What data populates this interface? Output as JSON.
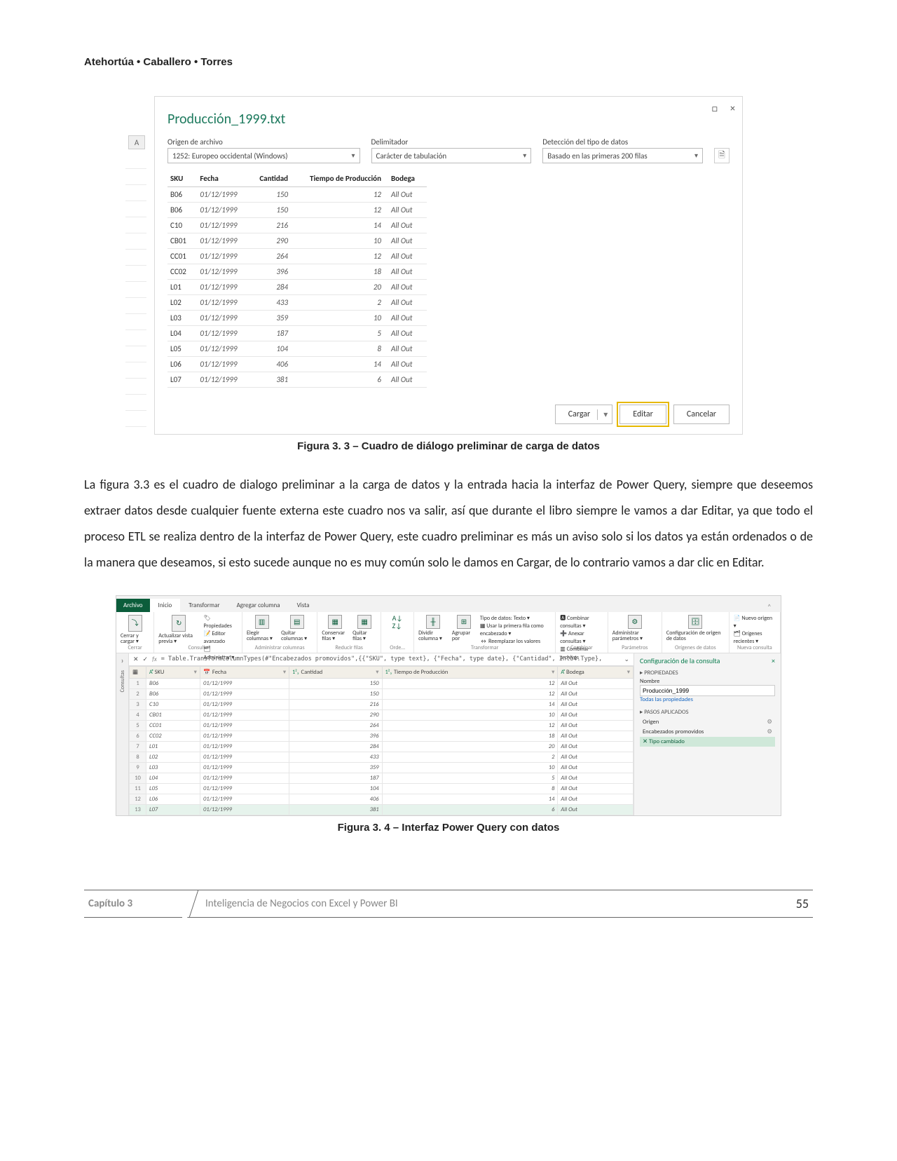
{
  "header_authors": "Atehortúa • Caballero • Torres",
  "fig33": {
    "window": {
      "minimize": "□",
      "close": "×"
    },
    "title": "Producción_1999.txt",
    "col_a": "A",
    "labels": {
      "origen": "Origen de archivo",
      "delim": "Delimitador",
      "detect": "Detección del tipo de datos"
    },
    "selects": {
      "origen": "1252: Europeo occidental (Windows)",
      "delim": "Carácter de tabulación",
      "detect": "Basado en las primeras 200 filas"
    },
    "doc_icon": "🗎",
    "headers": [
      "SKU",
      "Fecha",
      "Cantidad",
      "Tiempo de Producción",
      "Bodega"
    ],
    "rows": [
      [
        "B06",
        "01/12/1999",
        "150",
        "12",
        "All Out"
      ],
      [
        "B06",
        "01/12/1999",
        "150",
        "12",
        "All Out"
      ],
      [
        "C10",
        "01/12/1999",
        "216",
        "14",
        "All Out"
      ],
      [
        "CB01",
        "01/12/1999",
        "290",
        "10",
        "All Out"
      ],
      [
        "CC01",
        "01/12/1999",
        "264",
        "12",
        "All Out"
      ],
      [
        "CC02",
        "01/12/1999",
        "396",
        "18",
        "All Out"
      ],
      [
        "L01",
        "01/12/1999",
        "284",
        "20",
        "All Out"
      ],
      [
        "L02",
        "01/12/1999",
        "433",
        "2",
        "All Out"
      ],
      [
        "L03",
        "01/12/1999",
        "359",
        "10",
        "All Out"
      ],
      [
        "L04",
        "01/12/1999",
        "187",
        "5",
        "All Out"
      ],
      [
        "L05",
        "01/12/1999",
        "104",
        "8",
        "All Out"
      ],
      [
        "L06",
        "01/12/1999",
        "406",
        "14",
        "All Out"
      ],
      [
        "L07",
        "01/12/1999",
        "381",
        "6",
        "All Out"
      ]
    ],
    "buttons": {
      "cargar": "Cargar",
      "editar": "Editar",
      "cancelar": "Cancelar"
    },
    "caption": "Figura 3. 3 – Cuadro de diálogo preliminar de carga de datos"
  },
  "paragraph": "La figura 3.3 es el cuadro de dialogo preliminar a la carga de datos y la entrada hacia la interfaz de Power Query, siempre que deseemos extraer datos desde cualquier fuente externa este cuadro nos va salir, así que durante el libro siempre le vamos a dar Editar, ya que todo el proceso ETL se realiza dentro de la interfaz de Power Query, este cuadro preliminar es más un aviso solo si los datos ya están ordenados o de la manera que deseamos, si esto sucede aunque no es muy común solo le damos en Cargar, de lo contrario vamos a dar clic en Editar.",
  "fig34": {
    "tabs": {
      "file": "Archivo",
      "inicio": "Inicio",
      "transformar": "Transformar",
      "agregar": "Agregar columna",
      "vista": "Vista"
    },
    "ribbon_caps": {
      "cerrar": "Cerrar",
      "consulta": "Consulta",
      "admincol": "Administrar columnas",
      "reducir": "Reducir filas",
      "orde": "Orde…",
      "transformar": "Transformar",
      "combinar": "Combinar",
      "param": "Parámetros",
      "origenes": "Orígenes de datos",
      "nueva": "Nueva consulta"
    },
    "ribbon_labels": {
      "cerrar": "Cerrar y cargar ▾",
      "actualizar": "Actualizar vista previa ▾",
      "propiedades": "Propiedades",
      "editor": "Editor avanzado",
      "administrar": "Administrar ▾",
      "elegir": "Elegir columnas ▾",
      "quitar": "Quitar columnas ▾",
      "conservar": "Conservar filas ▾",
      "quitarf": "Quitar filas ▾",
      "dividir": "Dividir columna ▾",
      "agrupar": "Agrupar por",
      "tipo": "Tipo de datos: Texto ▾",
      "primera": "Usar la primera fila como encabezado ▾",
      "reemplazar": "Reemplazar los valores",
      "combinarc": "Combinar consultas ▾",
      "anexar": "Anexar consultas ▾",
      "combinararch": "Combinar archivos",
      "adminparam": "Administrar parámetros ▾",
      "config": "Configuración de origen de datos",
      "nuevoorigen": "Nuevo origen ▾",
      "recientes": "Orígenes recientes ▾"
    },
    "vertical_label": "Consultas",
    "formula": "= Table.TransformColumnTypes(#\"Encabezados promovidos\",{{\"SKU\", type text}, {\"Fecha\", type date}, {\"Cantidad\", Int64.Type},",
    "grid_headers": [
      "SKU",
      "Fecha",
      "Cantidad",
      "Tiempo de Producción",
      "Bodega"
    ],
    "grid_rows": [
      [
        "1",
        "B06",
        "01/12/1999",
        "150",
        "12",
        "All Out"
      ],
      [
        "2",
        "B06",
        "01/12/1999",
        "150",
        "12",
        "All Out"
      ],
      [
        "3",
        "C10",
        "01/12/1999",
        "216",
        "14",
        "All Out"
      ],
      [
        "4",
        "CB01",
        "01/12/1999",
        "290",
        "10",
        "All Out"
      ],
      [
        "5",
        "CC01",
        "01/12/1999",
        "264",
        "12",
        "All Out"
      ],
      [
        "6",
        "CC02",
        "01/12/1999",
        "396",
        "18",
        "All Out"
      ],
      [
        "7",
        "L01",
        "01/12/1999",
        "284",
        "20",
        "All Out"
      ],
      [
        "8",
        "L02",
        "01/12/1999",
        "433",
        "2",
        "All Out"
      ],
      [
        "9",
        "L03",
        "01/12/1999",
        "359",
        "10",
        "All Out"
      ],
      [
        "10",
        "L04",
        "01/12/1999",
        "187",
        "5",
        "All Out"
      ],
      [
        "11",
        "L05",
        "01/12/1999",
        "104",
        "8",
        "All Out"
      ],
      [
        "12",
        "L06",
        "01/12/1999",
        "406",
        "14",
        "All Out"
      ],
      [
        "13",
        "L07",
        "01/12/1999",
        "381",
        "6",
        "All Out"
      ]
    ],
    "right": {
      "title": "Configuración de la consulta",
      "prop_hdr": "PROPIEDADES",
      "nombre_lbl": "Nombre",
      "nombre_val": "Producción_1999",
      "todas": "Todas las propiedades",
      "pasos_hdr": "PASOS APLICADOS",
      "pasos": [
        {
          "label": "Origen",
          "gear": "⚙"
        },
        {
          "label": "Encabezados promovidos",
          "gear": "⚙"
        },
        {
          "label": "Tipo cambiado",
          "gear": ""
        }
      ]
    },
    "caption": "Figura 3. 4 – Interfaz Power Query con datos"
  },
  "footer": {
    "chapter": "Capítulo 3",
    "subtitle": "Inteligencia de Negocios con Excel y Power BI",
    "page": "55"
  }
}
